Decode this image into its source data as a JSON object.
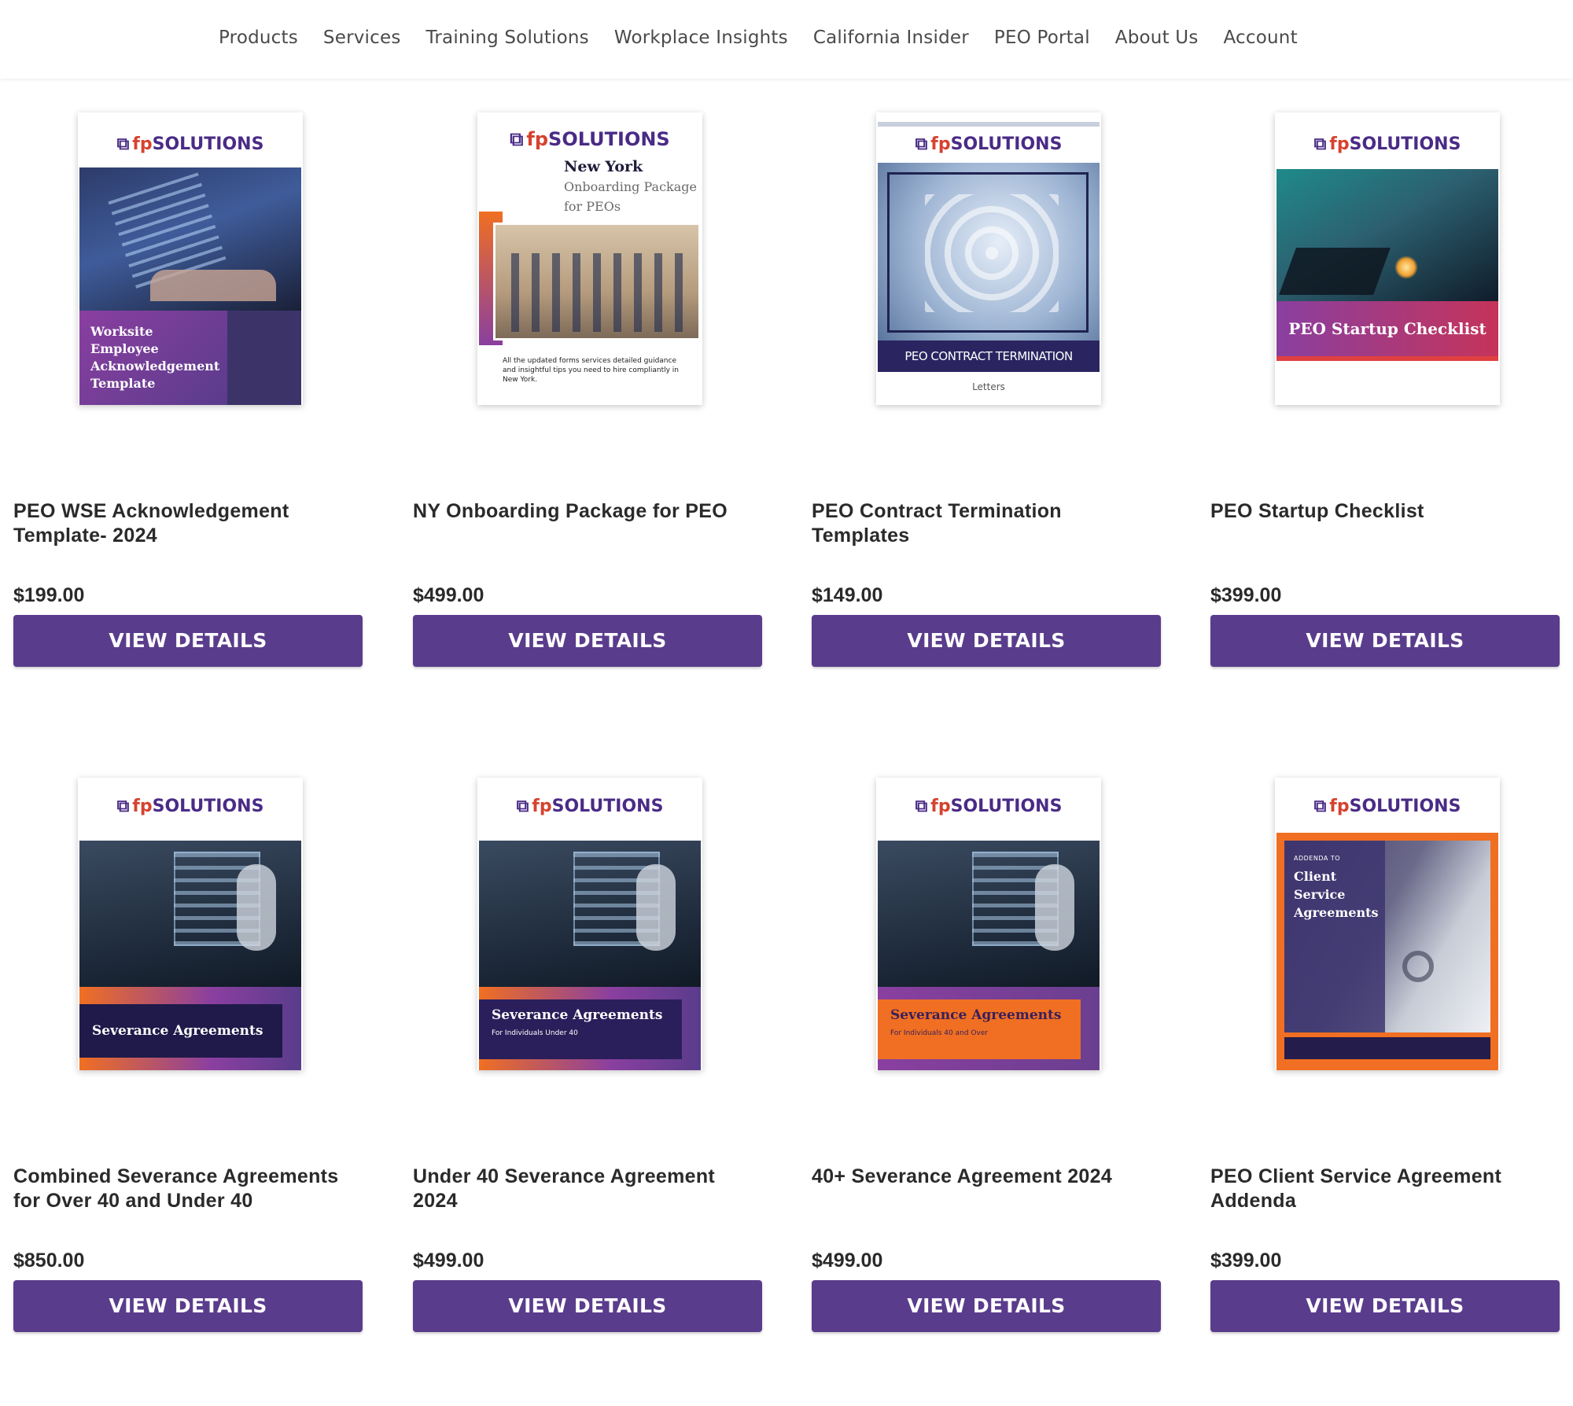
{
  "nav": {
    "items": [
      "Products",
      "Services",
      "Training Solutions",
      "Workplace Insights",
      "California Insider",
      "PEO Portal",
      "About Us",
      "Account"
    ]
  },
  "brand": {
    "logo_fp": "fp",
    "logo_rest": "SOLUTIONS"
  },
  "colors": {
    "accent": "#5a3c8c",
    "brand_purple": "#4a2b86",
    "brand_orange": "#f06f22"
  },
  "products": [
    {
      "title": "PEO WSE Acknowledgement Template- 2024",
      "price": "$199.00",
      "button": "VIEW DETAILS",
      "cover": {
        "band_text": "Worksite Employee Acknowledgement Template"
      }
    },
    {
      "title": "NY Onboarding Package for PEO",
      "price": "$499.00",
      "button": "VIEW DETAILS",
      "cover": {
        "heading": "New York",
        "subheading": "Onboarding Package for PEOs",
        "blurb": "All the updated forms services detailed guidance and insightful tips you need to hire compliantly in New York."
      }
    },
    {
      "title": "PEO Contract Termination Templates",
      "price": "$149.00",
      "button": "VIEW DETAILS",
      "cover": {
        "band_text": "PEO CONTRACT TERMINATION",
        "sub_text": "Letters"
      }
    },
    {
      "title": "PEO Startup Checklist",
      "price": "$399.00",
      "button": "VIEW DETAILS",
      "cover": {
        "band_text": "PEO Startup Checklist"
      }
    },
    {
      "title": "Combined Severance Agreements for Over 40 and Under 40",
      "price": "$850.00",
      "button": "VIEW DETAILS",
      "cover": {
        "band_text": "Severance Agreements"
      }
    },
    {
      "title": "Under 40 Severance Agreement 2024",
      "price": "$499.00",
      "button": "VIEW DETAILS",
      "cover": {
        "band_text": "Severance Agreements",
        "sub_text": "For Individuals Under 40"
      }
    },
    {
      "title": "40+ Severance Agreement 2024",
      "price": "$499.00",
      "button": "VIEW DETAILS",
      "cover": {
        "band_text": "Severance Agreements",
        "sub_text": "For Individuals 40 and Over"
      }
    },
    {
      "title": "PEO Client Service Agreement Addenda",
      "price": "$399.00",
      "button": "VIEW DETAILS",
      "cover": {
        "kicker": "ADDENDA TO",
        "band_text": "Client Service Agreements"
      }
    }
  ]
}
